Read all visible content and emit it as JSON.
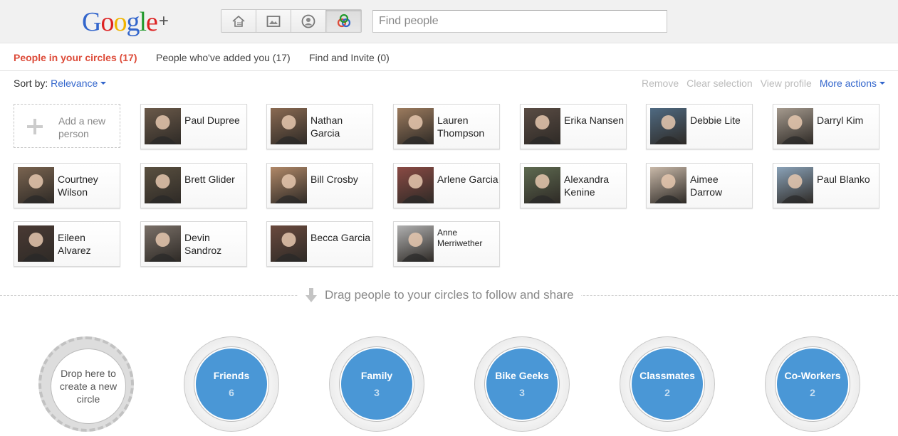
{
  "header": {
    "logo_text": "Google",
    "logo_plus": "+",
    "nav": [
      {
        "icon": "home-icon"
      },
      {
        "icon": "photos-icon"
      },
      {
        "icon": "profile-icon"
      },
      {
        "icon": "circles-icon",
        "active": true
      }
    ],
    "search_placeholder": "Find people"
  },
  "tabs": [
    {
      "label": "People in your circles (17)",
      "active": true
    },
    {
      "label": "People who've added you (17)",
      "active": false
    },
    {
      "label": "Find and Invite (0)",
      "active": false
    }
  ],
  "sort": {
    "label": "Sort by:",
    "value": "Relevance"
  },
  "actions": {
    "remove": "Remove",
    "clear": "Clear selection",
    "view": "View profile",
    "more": "More actions"
  },
  "add_person": {
    "label": "Add a new person"
  },
  "people": [
    {
      "name": "Paul Dupree",
      "color": "#6b5a4a"
    },
    {
      "name": "Nathan Garcia",
      "color": "#8a6a52"
    },
    {
      "name": "Lauren Thompson",
      "color": "#9c7b5e"
    },
    {
      "name": "Erika Nansen",
      "color": "#5a4c44"
    },
    {
      "name": "Debbie Lite",
      "color": "#4f6a82"
    },
    {
      "name": "Darryl Kim",
      "color": "#a59a8e"
    },
    {
      "name": "Courtney Wilson",
      "color": "#7a6450"
    },
    {
      "name": "Brett Glider",
      "color": "#5a5040"
    },
    {
      "name": "Bill Crosby",
      "color": "#b08868"
    },
    {
      "name": "Arlene Garcia",
      "color": "#8a4a44"
    },
    {
      "name": "Alexandra Kenine",
      "color": "#5e6a50"
    },
    {
      "name": "Aimee Darrow",
      "color": "#c8b8a8"
    },
    {
      "name": "Paul Blanko",
      "color": "#8aa2b8"
    },
    {
      "name": "Eileen Alvarez",
      "color": "#4a3a34"
    },
    {
      "name": "Devin Sandroz",
      "color": "#7a7068"
    },
    {
      "name": "Becca Garcia",
      "color": "#6a4a3e"
    },
    {
      "name": "Anne Merriwether",
      "color": "#b0b0b0",
      "small": true
    }
  ],
  "drag_hint": "Drag people to your circles to follow and share",
  "new_circle_label": "Drop here to create a new circle",
  "circles": [
    {
      "name": "Friends",
      "count": "6"
    },
    {
      "name": "Family",
      "count": "3"
    },
    {
      "name": "Bike Geeks",
      "count": "3"
    },
    {
      "name": "Classmates",
      "count": "2"
    },
    {
      "name": "Co-Workers",
      "count": "2"
    }
  ]
}
